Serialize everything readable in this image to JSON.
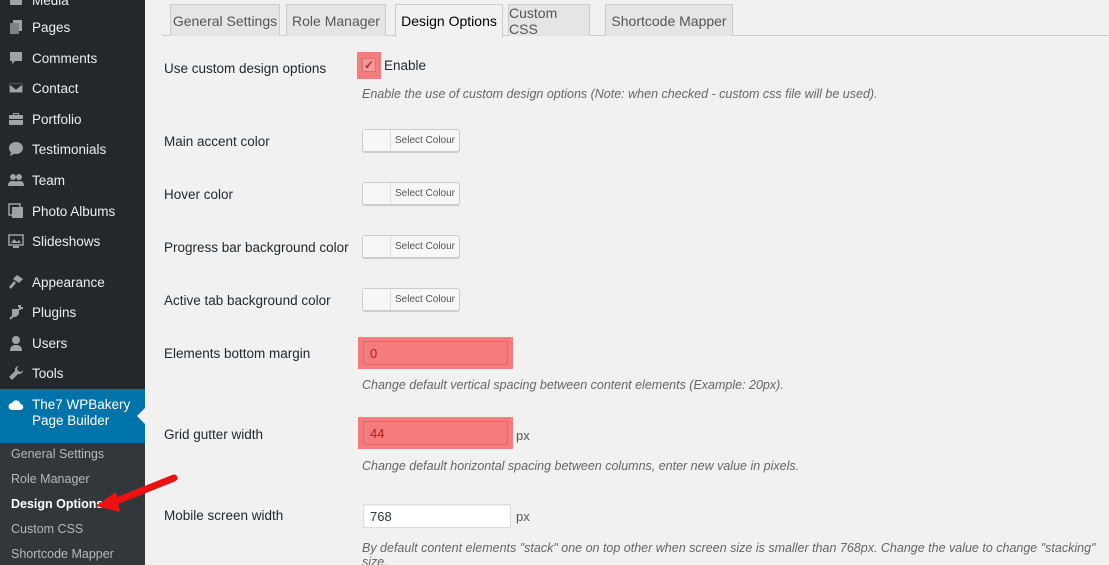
{
  "sidebar": {
    "items": [
      {
        "label": "Media",
        "icon": "media-icon"
      },
      {
        "label": "Pages",
        "icon": "pages-icon"
      },
      {
        "label": "Comments",
        "icon": "comments-icon"
      },
      {
        "label": "Contact",
        "icon": "envelope-icon"
      },
      {
        "label": "Portfolio",
        "icon": "briefcase-icon"
      },
      {
        "label": "Testimonials",
        "icon": "quote-bubble-icon"
      },
      {
        "label": "Team",
        "icon": "team-icon"
      },
      {
        "label": "Photo Albums",
        "icon": "photo-albums-icon"
      },
      {
        "label": "Slideshows",
        "icon": "slideshow-icon"
      },
      {
        "label": "Appearance",
        "icon": "paintbrush-icon"
      },
      {
        "label": "Plugins",
        "icon": "plugin-icon"
      },
      {
        "label": "Users",
        "icon": "user-icon"
      },
      {
        "label": "Tools",
        "icon": "wrench-icon"
      }
    ],
    "active": {
      "label": "The7 WPBakery Page Builder",
      "icon": "cloud-icon"
    },
    "submenu": [
      {
        "label": "General Settings",
        "current": false
      },
      {
        "label": "Role Manager",
        "current": false
      },
      {
        "label": "Design Options",
        "current": true
      },
      {
        "label": "Custom CSS",
        "current": false
      },
      {
        "label": "Shortcode Mapper",
        "current": false
      }
    ]
  },
  "tabs": [
    {
      "label": "General Settings",
      "active": false
    },
    {
      "label": "Role Manager",
      "active": false
    },
    {
      "label": "Design Options",
      "active": true
    },
    {
      "label": "Custom CSS",
      "active": false
    },
    {
      "label": "Shortcode Mapper",
      "active": false
    }
  ],
  "form": {
    "custom_design": {
      "label": "Use custom design options",
      "checkbox_label": "Enable",
      "checked": true,
      "description": "Enable the use of custom design options (Note: when checked - custom css file will be used)."
    },
    "colors": [
      {
        "label": "Main accent color",
        "button": "Select Colour"
      },
      {
        "label": "Hover color",
        "button": "Select Colour"
      },
      {
        "label": "Progress bar background color",
        "button": "Select Colour"
      },
      {
        "label": "Active tab background color",
        "button": "Select Colour"
      }
    ],
    "bottom_margin": {
      "label": "Elements bottom margin",
      "value": "0",
      "description": "Change default vertical spacing between content elements (Example: 20px)."
    },
    "gutter": {
      "label": "Grid gutter width",
      "value": "44",
      "unit": "px",
      "description": "Change default horizontal spacing between columns, enter new value in pixels."
    },
    "mobile_width": {
      "label": "Mobile screen width",
      "value": "768",
      "unit": "px",
      "description": "By default content elements \"stack\" one on top other when screen size is smaller than 768px. Change the value to change \"stacking\" size."
    }
  },
  "colors": {
    "sidebar_bg": "#23282d",
    "active_menu": "#0073aa",
    "highlight": "#f47c7c",
    "annotation_arrow": "#ee1111"
  }
}
